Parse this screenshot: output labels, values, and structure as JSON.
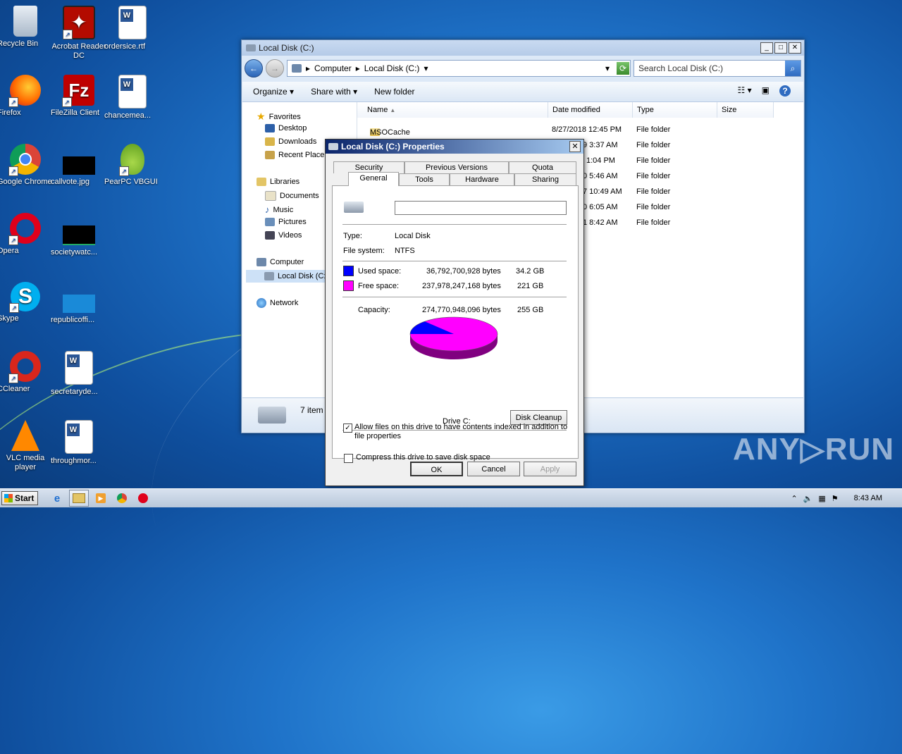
{
  "desktop": {
    "icons": [
      {
        "label": "Recycle Bin"
      },
      {
        "label": "Acrobat Reader DC"
      },
      {
        "label": "ordersice.rtf"
      },
      {
        "label": "Firefox"
      },
      {
        "label": "FileZilla Client"
      },
      {
        "label": "chancemea..."
      },
      {
        "label": "Google Chrome"
      },
      {
        "label": "callvote.jpg"
      },
      {
        "label": "PearPC VBGUI"
      },
      {
        "label": "Opera"
      },
      {
        "label": "societywatc..."
      },
      {
        "label": "Skype"
      },
      {
        "label": "republicoffi..."
      },
      {
        "label": "CCleaner"
      },
      {
        "label": "secretaryde..."
      },
      {
        "label": "VLC media player"
      },
      {
        "label": "throughmor..."
      }
    ]
  },
  "explorer": {
    "title": "Local Disk (C:)",
    "breadcrumb": [
      "Computer",
      "Local Disk (C:)"
    ],
    "search_placeholder": "Search Local Disk (C:)",
    "toolbar": {
      "organize": "Organize",
      "share_with": "Share with",
      "new_folder": "New folder"
    },
    "nav": {
      "favorites": "Favorites",
      "desktop": "Desktop",
      "downloads": "Downloads",
      "recent": "Recent Places",
      "libraries": "Libraries",
      "documents": "Documents",
      "music": "Music",
      "pictures": "Pictures",
      "videos": "Videos",
      "computer": "Computer",
      "local_disk": "Local Disk (C:",
      "network": "Network"
    },
    "columns": {
      "name": "Name",
      "date": "Date modified",
      "type": "Type",
      "size": "Size"
    },
    "rows": [
      {
        "name": "MSOCache",
        "date": "8/27/2018 12:45 PM",
        "type": "File folder"
      },
      {
        "date": "9 3:37 AM",
        "type": "File folder"
      },
      {
        "date": "1:04 PM",
        "type": "File folder"
      },
      {
        "date": "0 5:46 AM",
        "type": "File folder"
      },
      {
        "date": "7 10:49 AM",
        "type": "File folder"
      },
      {
        "date": "0 6:05 AM",
        "type": "File folder"
      },
      {
        "date": "1 8:42 AM",
        "type": "File folder"
      }
    ],
    "status": "7 item"
  },
  "dialog": {
    "title": "Local Disk (C:) Properties",
    "close": "✕",
    "tabs_back": [
      "Security",
      "Previous Versions",
      "Quota"
    ],
    "tabs_front": [
      "General",
      "Tools",
      "Hardware",
      "Sharing"
    ],
    "name_value": "",
    "type_label": "Type:",
    "type_value": "Local Disk",
    "fs_label": "File system:",
    "fs_value": "NTFS",
    "used_label": "Used space:",
    "used_bytes": "36,792,700,928 bytes",
    "used_gb": "34.2 GB",
    "free_label": "Free space:",
    "free_bytes": "237,978,247,168 bytes",
    "free_gb": "221 GB",
    "cap_label": "Capacity:",
    "cap_bytes": "274,770,948,096 bytes",
    "cap_gb": "255 GB",
    "drive_label": "Drive C:",
    "cleanup": "Disk Cleanup",
    "compress": "Compress this drive to save disk space",
    "index_line1": "Allow files on this drive to have contents indexed in addition to",
    "index_line2": "file properties",
    "ok": "OK",
    "cancel": "Cancel",
    "apply": "Apply",
    "used_color": "#0000ff",
    "free_color": "#ff00ff",
    "used_fraction": 0.134
  },
  "taskbar": {
    "start": "Start",
    "time": "8:43 AM"
  },
  "watermark": "ANY▷RUN"
}
